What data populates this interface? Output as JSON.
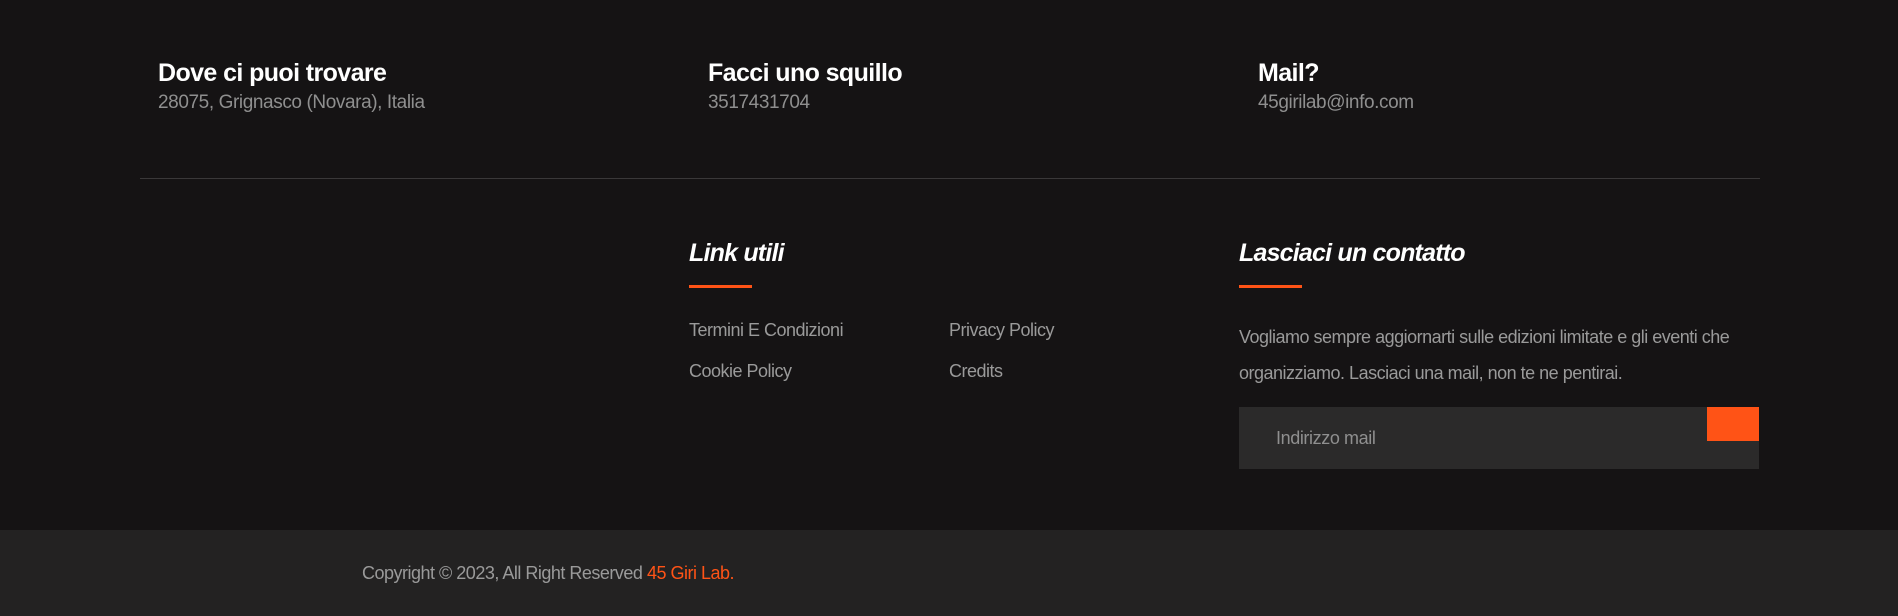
{
  "contact_info": {
    "location": {
      "title": "Dove ci puoi trovare",
      "value": "28075, Grignasco (Novara), Italia"
    },
    "phone": {
      "title": "Facci uno squillo",
      "value": "3517431704"
    },
    "email": {
      "title": "Mail?",
      "value": "45girilab@info.com"
    }
  },
  "useful_links": {
    "title": "Link utili",
    "items": [
      "Termini E Condizioni",
      "Privacy Policy",
      "Cookie Policy",
      "Credits"
    ]
  },
  "newsletter": {
    "title": "Lasciaci un contatto",
    "description": "Vogliamo sempre aggiornarti sulle edizioni limitate e gli eventi che organizziamo. Lasciaci una mail, non te ne pentirai.",
    "placeholder": "Indirizzo mail",
    "value": ""
  },
  "footer": {
    "copyright": "Copyright © 2023, All Right Reserved",
    "brand": "45 Giri Lab."
  },
  "colors": {
    "background": "#151314",
    "bottom_bar": "#232222",
    "accent": "#ff5316",
    "input_background": "#2b2a2a",
    "text_muted": "#9a9a9a",
    "heading": "#ffffff"
  }
}
